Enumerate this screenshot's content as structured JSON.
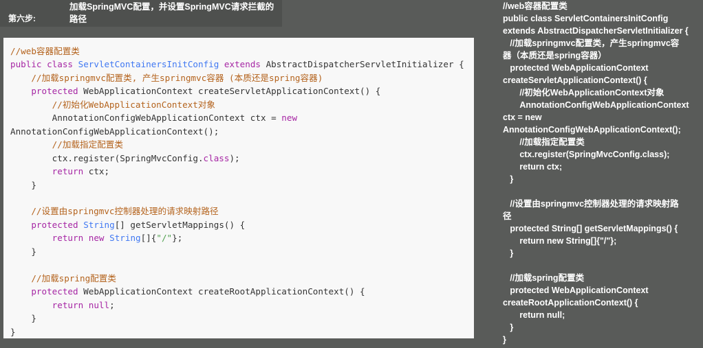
{
  "step": {
    "label": "第六步:",
    "text": "加载SpringMVC配置，并设置SpringMVC请求拦截的路径"
  },
  "code": {
    "lines": [
      [
        {
          "t": "//web容器配置类",
          "c": "c-com"
        }
      ],
      [
        {
          "t": "public",
          "c": "c-kw"
        },
        {
          "t": " ",
          "c": "c-pl"
        },
        {
          "t": "class",
          "c": "c-kw"
        },
        {
          "t": " ",
          "c": "c-pl"
        },
        {
          "t": "ServletContainersInitConfig",
          "c": "c-cls"
        },
        {
          "t": " ",
          "c": "c-pl"
        },
        {
          "t": "extends",
          "c": "c-kw"
        },
        {
          "t": " AbstractDispatcherServletInitializer {",
          "c": "c-pl"
        }
      ],
      [
        {
          "t": "    //加载springmvc配置类, 产生springmvc容器 (本质还是spring容器)",
          "c": "c-com"
        }
      ],
      [
        {
          "t": "    ",
          "c": "c-pl"
        },
        {
          "t": "protected",
          "c": "c-kw"
        },
        {
          "t": " WebApplicationContext createServletApplicationContext() {",
          "c": "c-pl"
        }
      ],
      [
        {
          "t": "        //初始化WebApplicationContext对象",
          "c": "c-com"
        }
      ],
      [
        {
          "t": "        AnnotationConfigWebApplicationContext ctx = ",
          "c": "c-pl"
        },
        {
          "t": "new",
          "c": "c-kw"
        }
      ],
      [
        {
          "t": "AnnotationConfigWebApplicationContext();",
          "c": "c-pl"
        }
      ],
      [
        {
          "t": "        //加载指定配置类",
          "c": "c-com"
        }
      ],
      [
        {
          "t": "        ctx.register(SpringMvcConfig.",
          "c": "c-pl"
        },
        {
          "t": "class",
          "c": "c-kw"
        },
        {
          "t": ");",
          "c": "c-pl"
        }
      ],
      [
        {
          "t": "        ",
          "c": "c-pl"
        },
        {
          "t": "return",
          "c": "c-kw"
        },
        {
          "t": " ctx;",
          "c": "c-pl"
        }
      ],
      [
        {
          "t": "    }",
          "c": "c-pl"
        }
      ],
      [
        {
          "t": "",
          "c": "c-pl"
        }
      ],
      [
        {
          "t": "    //设置由springmvc控制器处理的请求映射路径",
          "c": "c-com"
        }
      ],
      [
        {
          "t": "    ",
          "c": "c-pl"
        },
        {
          "t": "protected",
          "c": "c-kw"
        },
        {
          "t": " ",
          "c": "c-pl"
        },
        {
          "t": "String",
          "c": "c-cls"
        },
        {
          "t": "[] getServletMappings() {",
          "c": "c-pl"
        }
      ],
      [
        {
          "t": "        ",
          "c": "c-pl"
        },
        {
          "t": "return",
          "c": "c-kw"
        },
        {
          "t": " ",
          "c": "c-pl"
        },
        {
          "t": "new",
          "c": "c-kw"
        },
        {
          "t": " ",
          "c": "c-pl"
        },
        {
          "t": "String",
          "c": "c-cls"
        },
        {
          "t": "[]{",
          "c": "c-pl"
        },
        {
          "t": "\"/\"",
          "c": "c-str"
        },
        {
          "t": "};",
          "c": "c-pl"
        }
      ],
      [
        {
          "t": "    }",
          "c": "c-pl"
        }
      ],
      [
        {
          "t": "",
          "c": "c-pl"
        }
      ],
      [
        {
          "t": "    //加载spring配置类",
          "c": "c-com"
        }
      ],
      [
        {
          "t": "    ",
          "c": "c-pl"
        },
        {
          "t": "protected",
          "c": "c-kw"
        },
        {
          "t": " WebApplicationContext createRootApplicationContext() {",
          "c": "c-pl"
        }
      ],
      [
        {
          "t": "        ",
          "c": "c-pl"
        },
        {
          "t": "return",
          "c": "c-kw"
        },
        {
          "t": " ",
          "c": "c-pl"
        },
        {
          "t": "null",
          "c": "c-kw"
        },
        {
          "t": ";",
          "c": "c-pl"
        }
      ],
      [
        {
          "t": "    }",
          "c": "c-pl"
        }
      ],
      [
        {
          "t": "}",
          "c": "c-pl"
        }
      ]
    ]
  },
  "plain": {
    "lines": [
      "//web容器配置类",
      "public class ServletContainersInitConfig",
      "extends AbstractDispatcherServletInitializer {",
      "   //加载springmvc配置类，产生springmvc容",
      "器（本质还是spring容器）",
      "   protected WebApplicationContext",
      "createServletApplicationContext() {",
      "       //初始化WebApplicationContext对象",
      "       AnnotationConfigWebApplicationContext",
      "ctx = new",
      "AnnotationConfigWebApplicationContext();",
      "       //加载指定配置类",
      "       ctx.register(SpringMvcConfig.class);",
      "       return ctx;",
      "   }",
      "",
      "   //设置由springmvc控制器处理的请求映射路",
      "径",
      "   protected String[] getServletMappings() {",
      "       return new String[]{\"/\"};",
      "   }",
      "",
      "   //加载spring配置类",
      "   protected WebApplicationContext",
      "createRootApplicationContext() {",
      "       return null;",
      "   }",
      "}"
    ]
  }
}
